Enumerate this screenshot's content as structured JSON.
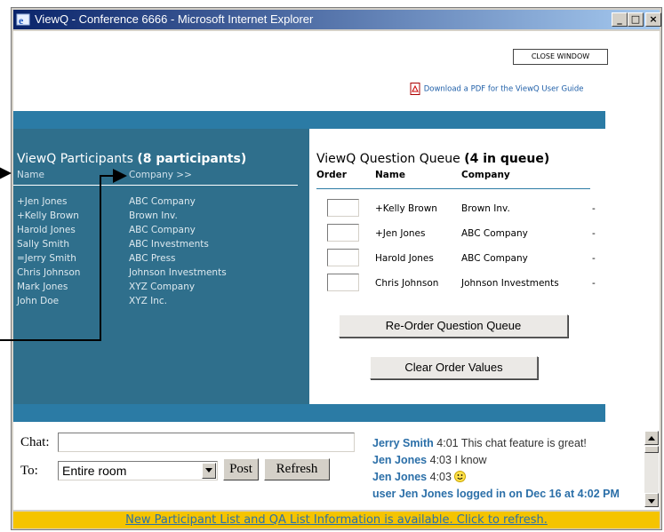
{
  "window": {
    "title": "ViewQ - Conference 6666 - Microsoft Internet Explorer",
    "controls": {
      "minimize": "_",
      "maximize": "□",
      "close": "×"
    }
  },
  "header": {
    "close_window": "CLOSE WINDOW",
    "pdf_link": "Download a PDF for the ViewQ User Guide"
  },
  "participants": {
    "title": "ViewQ Participants",
    "count": "(8 participants)",
    "col_name": "Name",
    "col_company": "Company >>",
    "names": [
      "+Jen Jones",
      "+Kelly Brown",
      "Harold Jones",
      "Sally Smith",
      "=Jerry Smith",
      "Chris Johnson",
      "Mark Jones",
      "John Doe"
    ],
    "companies": [
      "ABC Company",
      "Brown Inv.",
      "ABC Company",
      "ABC Investments",
      "ABC Press",
      "Johnson Investments",
      "XYZ Company",
      "XYZ Inc."
    ]
  },
  "queue": {
    "title": "ViewQ Question Queue",
    "count": "(4 in queue)",
    "col_order": "Order",
    "col_name": "Name",
    "col_company": "Company",
    "rows": [
      {
        "name": "+Kelly Brown",
        "company": "Brown Inv.",
        "dash": "-"
      },
      {
        "name": "+Jen Jones",
        "company": "ABC Company",
        "dash": "-"
      },
      {
        "name": "Harold Jones",
        "company": "ABC Company",
        "dash": "-"
      },
      {
        "name": "Chris Johnson",
        "company": "Johnson Investments",
        "dash": "-"
      }
    ],
    "reorder_button": "Re-Order Question Queue",
    "clear_button": "Clear Order Values"
  },
  "chat": {
    "chat_label": "Chat:",
    "to_label": "To:",
    "to_selected": "Entire room",
    "post_button": "Post",
    "refresh_button": "Refresh",
    "messages": [
      {
        "who": "Jerry Smith",
        "time": "4:01",
        "text": "This chat feature is great!"
      },
      {
        "who": "Jen Jones",
        "time": "4:03",
        "text": "I know"
      },
      {
        "who": "Jen Jones",
        "time": "4:03",
        "text": ""
      }
    ],
    "system_message": "user Jen Jones logged in on Dec 16 at 4:02 PM"
  },
  "notice": "New Participant List and QA List Information is available. Click to refresh.",
  "colors": {
    "panel_dark": "#2f6f8c",
    "bar_blue": "#2b7ba5",
    "notice_yellow": "#f5c400",
    "link_blue": "#2b6fa8"
  }
}
